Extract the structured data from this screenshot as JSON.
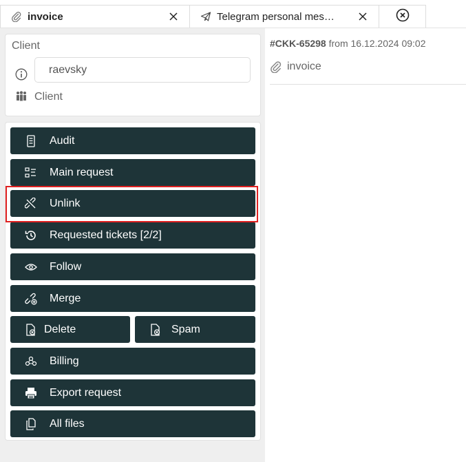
{
  "tabs": [
    {
      "label": "invoice",
      "icon": "paperclip-icon",
      "active": true
    },
    {
      "label": "Telegram personal mes…",
      "icon": "telegram-icon",
      "active": false
    }
  ],
  "client": {
    "title": "Client",
    "input_value": "raevsky",
    "link_label": "Client"
  },
  "actions": {
    "audit": "Audit",
    "main_request": "Main request",
    "unlink": "Unlink",
    "requested_tickets": "Requested tickets [2/2]",
    "follow": "Follow",
    "merge": "Merge",
    "delete": "Delete",
    "spam": "Spam",
    "billing": "Billing",
    "export_request": "Export request",
    "all_files": "All files"
  },
  "ticket": {
    "id": "#CKK-65298",
    "from_text": "from 16.12.2024 09:02",
    "subject": "invoice"
  },
  "colors": {
    "button_bg": "#1e3438",
    "highlight": "#e02020"
  }
}
